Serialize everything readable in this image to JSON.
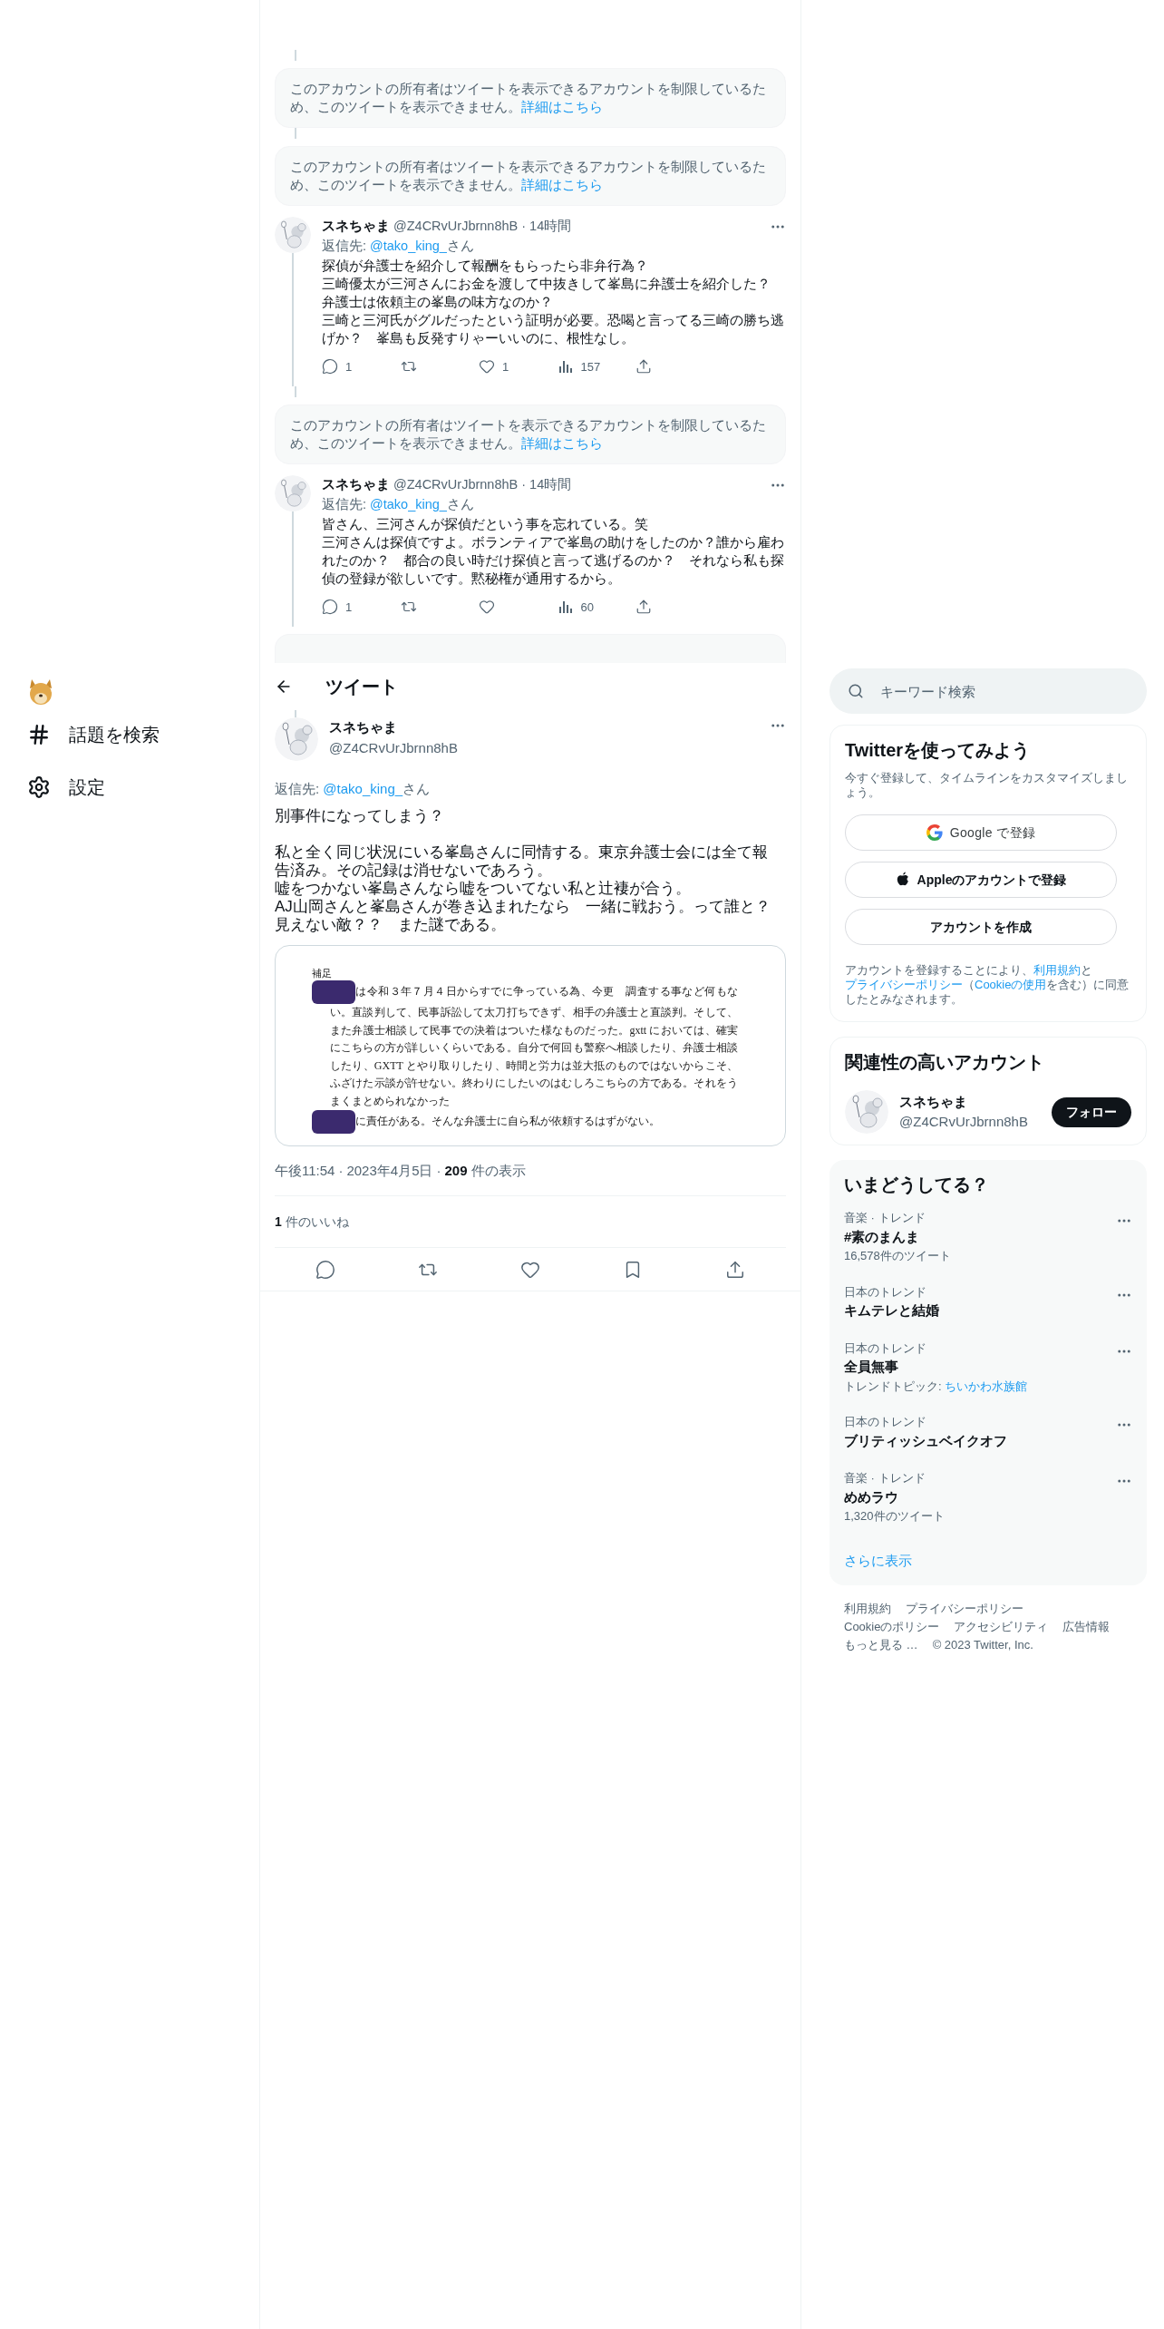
{
  "left_nav": {
    "items": [
      {
        "kind": "explore",
        "label": "話題を検索"
      },
      {
        "kind": "settings",
        "label": "設定"
      }
    ]
  },
  "thread": [
    {
      "kind": "restricted",
      "text": "このアカウントの所有者はツイートを表示できるアカウントを制限しているため、このツイートを表示できません。",
      "link": "詳細はこちら"
    },
    {
      "kind": "restricted",
      "text": "このアカウントの所有者はツイートを表示できるアカウントを制限しているため、このツイートを表示できません。",
      "link": "詳細はこちら"
    },
    {
      "kind": "tweet",
      "name": "スネちゃま",
      "handle": "@Z4CRvUrJbrnn8hB",
      "separator": "·",
      "time": "14時間",
      "reply_prefix": "返信先: ",
      "reply_to": "@tako_king_",
      "reply_suffix": "さん",
      "lines": [
        "探偵が弁護士を紹介して報酬をもらったら非弁行為？",
        "三崎優太が三河さんにお金を渡して中抜きして峯島に弁護士を紹介した？",
        "弁護士は依頼主の峯島の味方なのか？",
        "三崎と三河氏がグルだったという証明が必要。恐喝と言ってる三崎の勝ち逃げか？　峯島も反発すりゃーいいのに、根性なし。"
      ],
      "actions": [
        {
          "kind": "reply",
          "count": "1"
        },
        {
          "kind": "retweet"
        },
        {
          "kind": "like",
          "count": "1"
        },
        {
          "kind": "views",
          "count": "157"
        },
        {
          "kind": "share"
        }
      ]
    },
    {
      "kind": "restricted",
      "text": "このアカウントの所有者はツイートを表示できるアカウントを制限しているため、このツイートを表示できません。",
      "link": "詳細はこちら"
    },
    {
      "kind": "tweet",
      "name": "スネちゃま",
      "handle": "@Z4CRvUrJbrnn8hB",
      "separator": "·",
      "time": "14時間",
      "reply_prefix": "返信先: ",
      "reply_to": "@tako_king_",
      "reply_suffix": "さん",
      "lines": [
        "皆さん、三河さんが探偵だという事を忘れている。笑",
        "三河さんは探偵ですよ。ボランティアで峯島の助けをしたのか？誰から雇われたのか？　都合の良い時だけ探偵と言って逃げるのか？　それなら私も探偵の登録が欲しいです。黙秘権が通用するから。"
      ],
      "actions": [
        {
          "kind": "reply",
          "count": "1"
        },
        {
          "kind": "retweet"
        },
        {
          "kind": "like"
        },
        {
          "kind": "views",
          "count": "60"
        },
        {
          "kind": "share"
        }
      ]
    },
    {
      "kind": "restricted_hidden"
    }
  ],
  "header": {
    "title": "ツイート"
  },
  "main_tweet": {
    "name": "スネちゃま",
    "handle": "@Z4CRvUrJbrnn8hB",
    "reply_prefix": "返信先: ",
    "reply_to": "@tako_king_",
    "reply_suffix": "さん",
    "paragraphs": [
      [
        "別事件になってしまう？"
      ],
      [
        "私と全く同じ状況にいる峯島さんに同情する。東京弁護士会には全て報告済み。その記録は消せないであろう。",
        "嘘をつかない峯島さんなら嘘をついてない私と辻褄が合う。",
        "AJ山岡さんと峯島さんが巻き込まれたなら　一緒に戦おう。って誰と？見えない敵？？　また謎である。"
      ]
    ],
    "document": {
      "heading": "補足",
      "paragraphs": [
        [
          {
            "kind": "redacted"
          },
          {
            "kind": "text",
            "text": "は令和３年７月４日からすでに争っている為、今更　調査する事など何もない。直談判して、民事訴訟して太刀打ちできず、相手の弁護士と直談判。そして、また弁護士相談して民事での決着はついた様なものだった。gxtt においては、確実にこちらの方が詳しいくらいである。自分で何回も警察へ相談したり、弁護士相談したり、GXTT とやり取りしたり、時間と労力は並大抵のものではないからこそ、ふざけた示談が許せない。終わりにしたいのはむしろこちらの方である。それをうまくまとめられなかった"
          }
        ],
        [
          {
            "kind": "redacted"
          },
          {
            "kind": "text",
            "text": "に責任がある。そんな弁護士に自ら私が依頼するはずがない。"
          }
        ]
      ]
    },
    "time": "午後11:54",
    "separator": "·",
    "date": "2023年4月5日",
    "views_count": "209",
    "views_label": "件の表示",
    "likes_count": "1",
    "likes_label": "件のいいね",
    "actions": [
      {
        "kind": "reply"
      },
      {
        "kind": "retweet"
      },
      {
        "kind": "like"
      },
      {
        "kind": "bookmark"
      },
      {
        "kind": "share"
      }
    ]
  },
  "search": {
    "placeholder": "キーワード検索"
  },
  "signup": {
    "title": "Twitterを使ってみよう",
    "subtitle": "今すぐ登録して、タイムラインをカスタマイズしましょう。",
    "buttons": [
      {
        "kind": "google",
        "label": "Google で登録"
      },
      {
        "kind": "apple",
        "label": "Appleのアカウントで登録"
      },
      {
        "kind": "create",
        "label": "アカウントを作成"
      }
    ],
    "legal": [
      {
        "kind": "text",
        "text": "アカウントを登録することにより、"
      },
      {
        "kind": "link",
        "text": "利用規約"
      },
      {
        "kind": "text",
        "text": "と"
      },
      {
        "kind": "link",
        "text": "プライバシーポリシー"
      },
      {
        "kind": "text",
        "text": "（"
      },
      {
        "kind": "link",
        "text": "Cookieの使用"
      },
      {
        "kind": "text",
        "text": "を含む）に同意したとみなされます。"
      }
    ]
  },
  "related": {
    "title": "関連性の高いアカウント",
    "accounts": [
      {
        "name": "スネちゃま",
        "handle": "@Z4CRvUrJbrnn8hB",
        "button": "フォロー"
      }
    ]
  },
  "trends": {
    "title": "いまどうしてる？",
    "items": [
      {
        "category": "音楽 · トレンド",
        "title": "#素のまんま",
        "count": "16,578件のツイート"
      },
      {
        "category": "日本のトレンド",
        "title": "キムテレと結婚"
      },
      {
        "category": "日本のトレンド",
        "title": "全員無事",
        "topic_prefix": "トレンドトピック: ",
        "topic_link": "ちいかわ水族館"
      },
      {
        "category": "日本のトレンド",
        "title": "ブリティッシュベイクオフ"
      },
      {
        "category": "音楽 · トレンド",
        "title": "めめラウ",
        "count": "1,320件のツイート"
      }
    ],
    "more": "さらに表示"
  },
  "footer": {
    "links": [
      "利用規約",
      "プライバシーポリシー",
      "Cookieのポリシー",
      "アクセシビリティ",
      "広告情報",
      "もっと見る …"
    ],
    "copyright": "© 2023 Twitter, Inc."
  }
}
